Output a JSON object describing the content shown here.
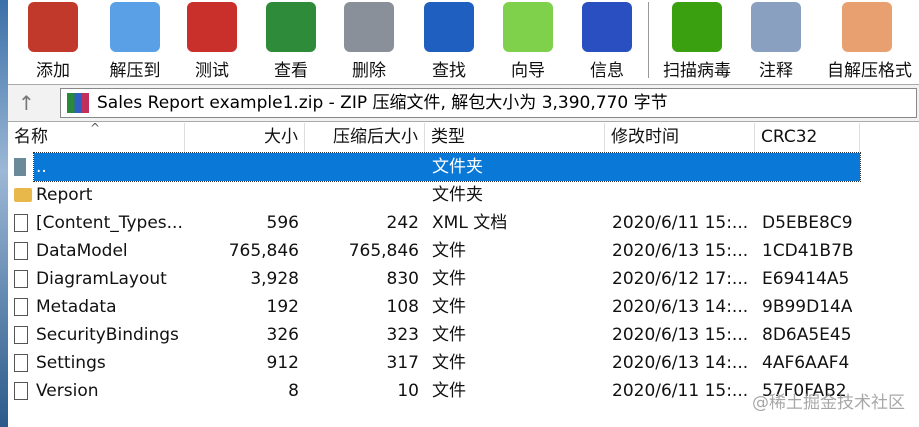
{
  "toolbar": [
    {
      "label": "添加",
      "icon": "add-archive-icon",
      "color": "#c0392b"
    },
    {
      "label": "解压到",
      "icon": "extract-folder-icon",
      "color": "#5aa0e6"
    },
    {
      "label": "测试",
      "icon": "test-clipboard-icon",
      "color": "#c9302c"
    },
    {
      "label": "查看",
      "icon": "view-book-icon",
      "color": "#2e8b3a"
    },
    {
      "label": "删除",
      "icon": "delete-trash-icon",
      "color": "#8a9099"
    },
    {
      "label": "查找",
      "icon": "find-magnifier-icon",
      "color": "#1f5fc0"
    },
    {
      "label": "向导",
      "icon": "wizard-wand-icon",
      "color": "#7fd04a"
    },
    {
      "label": "信息",
      "icon": "info-icon",
      "color": "#2a4fc0"
    },
    {
      "label": "扫描病毒",
      "icon": "virus-scan-icon",
      "color": "#3aa010"
    },
    {
      "label": "注释",
      "icon": "comment-icon",
      "color": "#8aa0c0"
    },
    {
      "label": "自解压格式",
      "icon": "sfx-box-icon",
      "color": "#e8a070"
    }
  ],
  "address": {
    "text": "Sales Report example1.zip - ZIP 压缩文件, 解包大小为 3,390,770 字节"
  },
  "columns": {
    "name": "名称",
    "size": "大小",
    "packed": "压缩后大小",
    "type": "类型",
    "modified": "修改时间",
    "crc": "CRC32"
  },
  "rows": [
    {
      "name": "..",
      "size": "",
      "packed": "",
      "type": "文件夹",
      "modified": "",
      "crc": "",
      "kind": "up"
    },
    {
      "name": "Report",
      "size": "",
      "packed": "",
      "type": "文件夹",
      "modified": "",
      "crc": "",
      "kind": "folder"
    },
    {
      "name": "[Content_Types...",
      "size": "596",
      "packed": "242",
      "type": "XML 文档",
      "modified": "2020/6/11 15:...",
      "crc": "D5EBE8C9",
      "kind": "file"
    },
    {
      "name": "DataModel",
      "size": "765,846",
      "packed": "765,846",
      "type": "文件",
      "modified": "2020/6/13 15:...",
      "crc": "1CD41B7B",
      "kind": "file"
    },
    {
      "name": "DiagramLayout",
      "size": "3,928",
      "packed": "830",
      "type": "文件",
      "modified": "2020/6/12 17:...",
      "crc": "E69414A5",
      "kind": "file"
    },
    {
      "name": "Metadata",
      "size": "192",
      "packed": "108",
      "type": "文件",
      "modified": "2020/6/13 14:...",
      "crc": "9B99D14A",
      "kind": "file"
    },
    {
      "name": "SecurityBindings",
      "size": "326",
      "packed": "323",
      "type": "文件",
      "modified": "2020/6/13 15:...",
      "crc": "8D6A5E45",
      "kind": "file"
    },
    {
      "name": "Settings",
      "size": "912",
      "packed": "317",
      "type": "文件",
      "modified": "2020/6/13 14:...",
      "crc": "4AF6AAF4",
      "kind": "file"
    },
    {
      "name": "Version",
      "size": "8",
      "packed": "10",
      "type": "文件",
      "modified": "2020/6/11 15:...",
      "crc": "57F0FAB2",
      "kind": "file"
    }
  ],
  "watermark": "@稀土掘金技术社区"
}
